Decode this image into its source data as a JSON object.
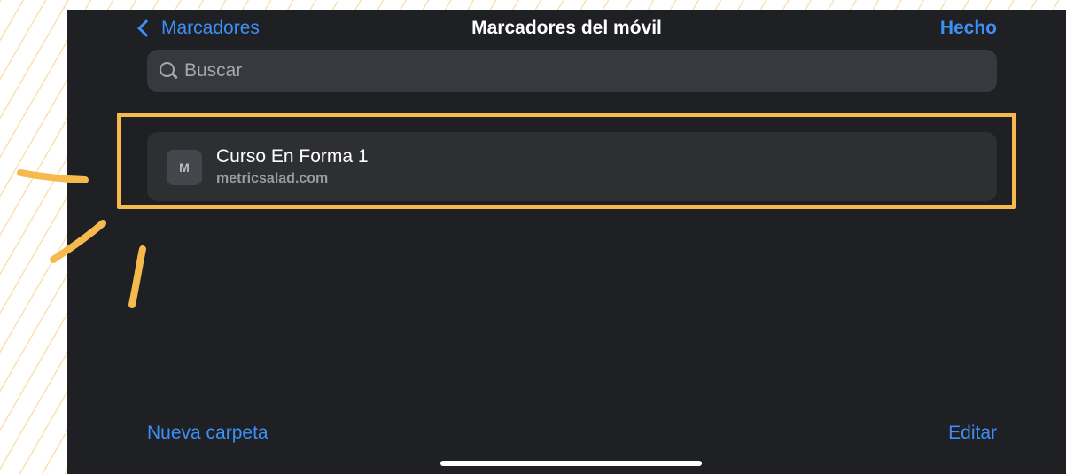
{
  "nav": {
    "back_label": "Marcadores",
    "title": "Marcadores del móvil",
    "done_label": "Hecho"
  },
  "search": {
    "placeholder": "Buscar",
    "value": ""
  },
  "bookmarks": [
    {
      "favicon_letter": "M",
      "title": "Curso En Forma 1",
      "url": "metricsalad.com"
    }
  ],
  "toolbar": {
    "new_folder_label": "Nueva carpeta",
    "edit_label": "Editar"
  },
  "colors": {
    "accent": "#3d8ff5",
    "background": "#1f2024",
    "highlight": "#f6b94c"
  },
  "icons": {
    "back": "chevron-left-icon",
    "search": "search-icon",
    "favicon": "favicon-icon"
  }
}
